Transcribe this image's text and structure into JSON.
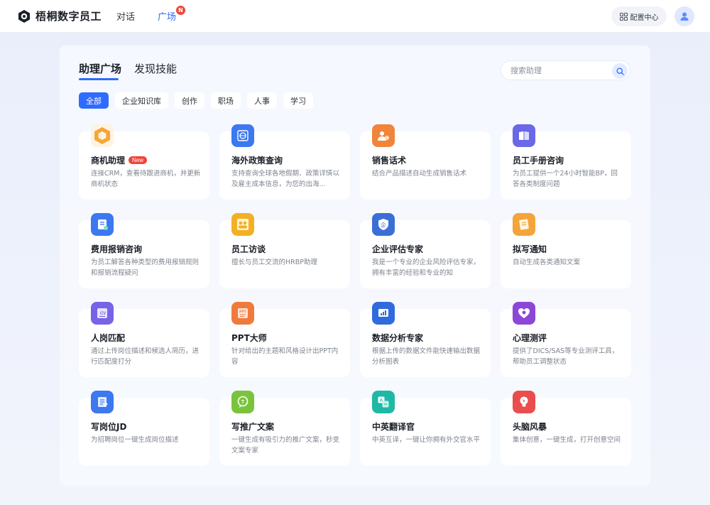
{
  "header": {
    "brand": "梧桐数字员工",
    "nav": [
      {
        "label": "对话",
        "active": false
      },
      {
        "label": "广场",
        "active": true,
        "badge": "N"
      }
    ],
    "config_label": "配置中心"
  },
  "main": {
    "tabs": [
      {
        "label": "助理广场",
        "active": true
      },
      {
        "label": "发现技能",
        "active": false
      }
    ],
    "search": {
      "placeholder": "搜索助理",
      "value": ""
    },
    "filters": [
      {
        "label": "全部",
        "active": true
      },
      {
        "label": "企业知识库",
        "active": false
      },
      {
        "label": "创作",
        "active": false
      },
      {
        "label": "职场",
        "active": false
      },
      {
        "label": "人事",
        "active": false
      },
      {
        "label": "学习",
        "active": false
      }
    ],
    "cards": [
      {
        "title": "商机助理",
        "badge": "New",
        "desc": "连接CRM，查看待跟进商机，并更新商机状态",
        "icon": "hexagon-icon",
        "color": "#f6a53a"
      },
      {
        "title": "海外政策查询",
        "desc": "支持查询全球各地假期、政策详情以及雇主成本信息，为您的出海...",
        "icon": "globe-policy-icon",
        "color": "#3c78f0"
      },
      {
        "title": "销售话术",
        "desc": "结合产品描述自动生成销售话术",
        "icon": "sales-people-icon",
        "color": "#f2833a"
      },
      {
        "title": "员工手册咨询",
        "desc": "为员工提供一个24小时智能BP，回答各类制度问题",
        "icon": "handbook-icon",
        "color": "#6a68e6"
      },
      {
        "title": "费用报销咨询",
        "desc": "为员工解答各种类型的费用报销规则和报销流程疑问",
        "icon": "expense-doc-icon",
        "color": "#3c78f0"
      },
      {
        "title": "员工访谈",
        "desc": "擅长与员工交流的HRBP助理",
        "icon": "interview-people-icon",
        "color": "#f2b022"
      },
      {
        "title": "企业评估专家",
        "desc": "我是一个专业的企业风险评估专家，拥有丰富的经验和专业的知",
        "icon": "enterprise-shield-icon",
        "color": "#3c6fd6"
      },
      {
        "title": "拟写通知",
        "desc": "自动生成各类通知文案",
        "icon": "notice-doc-icon",
        "color": "#f4a43a"
      },
      {
        "title": "人岗匹配",
        "desc": "通过上传岗位描述和候选人简历，进行匹配度打分",
        "icon": "cv-icon",
        "color": "#7663e8"
      },
      {
        "title": "PPT大师",
        "desc": "针对给出的主题和风格设计出PPT内容",
        "icon": "ppt-icon",
        "color": "#f07a3c"
      },
      {
        "title": "数据分析专家",
        "desc": "根据上传的数据文件能快速输出数据分析图表",
        "icon": "data-chart-icon",
        "color": "#2f6bdc"
      },
      {
        "title": "心理测评",
        "desc": "提供了DICS/SAS等专业测评工具，帮助员工调整状态",
        "icon": "heart-brain-icon",
        "color": "#8c47d8"
      },
      {
        "title": "写岗位JD",
        "desc": "为招聘岗位一键生成岗位描述",
        "icon": "jd-doc-icon",
        "color": "#3c78f0"
      },
      {
        "title": "写推广文案",
        "desc": "一键生成有吸引力的推广文案，秒变文案专家",
        "icon": "promo-bubble-icon",
        "color": "#7ac43c"
      },
      {
        "title": "中英翻译官",
        "desc": "中英互译，一键让你拥有外交官水平",
        "icon": "translate-icon",
        "color": "#1fb8a6"
      },
      {
        "title": "头脑风暴",
        "desc": "集体创意，一键生成，打开创意空间",
        "icon": "brainstorm-bulb-icon",
        "color": "#ea4d4d"
      }
    ]
  }
}
